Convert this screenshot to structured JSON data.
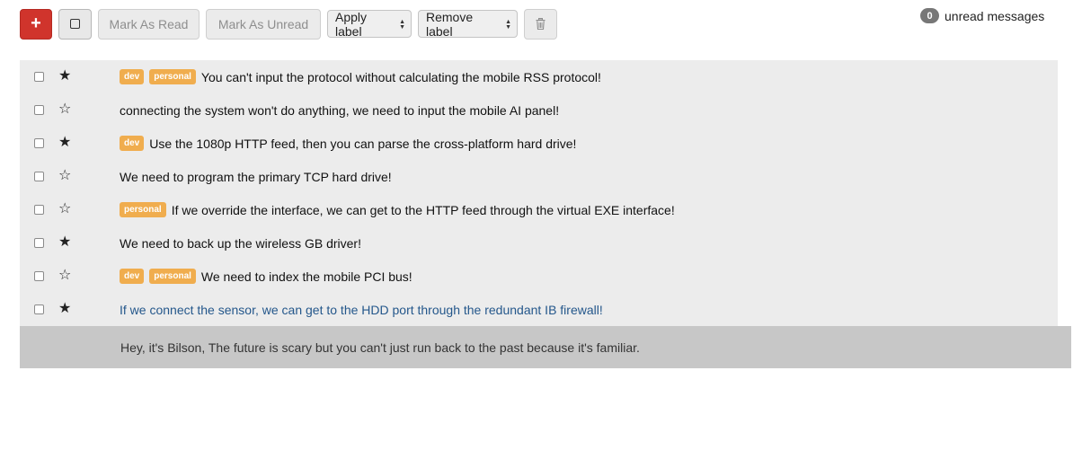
{
  "toolbar": {
    "compose_label": "+",
    "mark_read_label": "Mark As Read",
    "mark_unread_label": "Mark As Unread",
    "apply_label": "Apply label",
    "remove_label": "Remove label",
    "delete_icon": "🗑"
  },
  "unread": {
    "count": "0",
    "label": "unread messages"
  },
  "icons": {
    "star_filled": "★",
    "star_empty": "☆"
  },
  "messages": [
    {
      "starred": true,
      "labels": [
        "dev",
        "personal"
      ],
      "subject": "You can't input the protocol without calculating the mobile RSS protocol!"
    },
    {
      "starred": false,
      "labels": [],
      "subject": "connecting the system won't do anything, we need to input the mobile AI panel!"
    },
    {
      "starred": true,
      "labels": [
        "dev"
      ],
      "subject": "Use the 1080p HTTP feed, then you can parse the cross-platform hard drive!"
    },
    {
      "starred": false,
      "labels": [],
      "subject": "We need to program the primary TCP hard drive!"
    },
    {
      "starred": false,
      "labels": [
        "personal"
      ],
      "subject": "If we override the interface, we can get to the HTTP feed through the virtual EXE interface!"
    },
    {
      "starred": true,
      "labels": [],
      "subject": "We need to back up the wireless GB driver!"
    },
    {
      "starred": false,
      "labels": [
        "dev",
        "personal"
      ],
      "subject": "We need to index the mobile PCI bus!"
    },
    {
      "starred": true,
      "labels": [],
      "subject": "If we connect the sensor, we can get to the HDD port through the redundant IB firewall!"
    }
  ],
  "expanded_body": "Hey, it's Bilson, The future is scary but you can't just run back to the past because it's familiar.",
  "colors": {
    "compose": "#d0342c",
    "label": "#f0ad4e",
    "open_subject": "#24578b",
    "row_bg": "#ececec",
    "expanded_bg": "#c7c7c7"
  }
}
